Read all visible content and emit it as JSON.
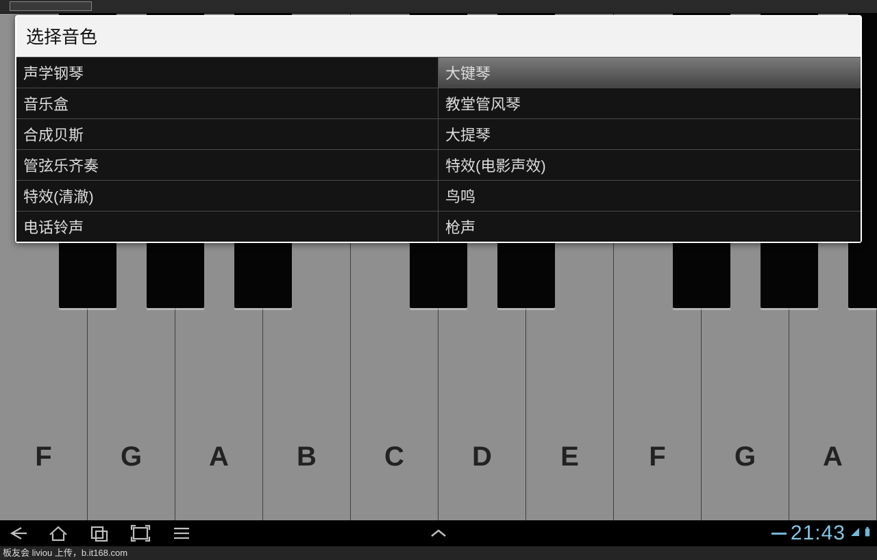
{
  "dialog": {
    "title": "选择音色",
    "options": [
      {
        "label": "声学钢琴",
        "selected": false
      },
      {
        "label": "大键琴",
        "selected": true
      },
      {
        "label": "音乐盒",
        "selected": false
      },
      {
        "label": "教堂管风琴",
        "selected": false
      },
      {
        "label": "合成贝斯",
        "selected": false
      },
      {
        "label": "大提琴",
        "selected": false
      },
      {
        "label": "管弦乐齐奏",
        "selected": false
      },
      {
        "label": "特效(电影声效)",
        "selected": false
      },
      {
        "label": "特效(清澈)",
        "selected": false
      },
      {
        "label": "鸟鸣",
        "selected": false
      },
      {
        "label": "电话铃声",
        "selected": false
      },
      {
        "label": "枪声",
        "selected": false
      }
    ]
  },
  "piano": {
    "white_keys": [
      "F",
      "G",
      "A",
      "B",
      "C",
      "D",
      "E",
      "F",
      "G",
      "A"
    ],
    "black_key_positions": [
      0,
      1,
      2,
      4,
      5,
      7,
      8,
      9
    ]
  },
  "statusbar": {
    "time": "21:43"
  },
  "watermark": "板友会 liviou 上传，b.it168.com"
}
